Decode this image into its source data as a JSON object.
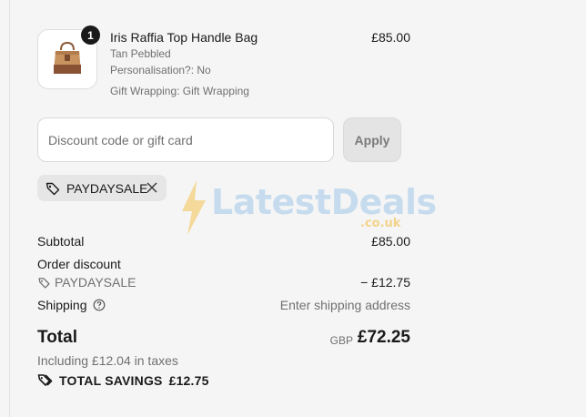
{
  "cart_item": {
    "quantity": "1",
    "title": "Iris Raffia Top Handle Bag",
    "price": "£85.00",
    "variant": "Tan Pebbled",
    "personalisation": "Personalisation?: No",
    "gift_wrapping": "Gift Wrapping: Gift Wrapping",
    "thumbnail_icon": "handbag-icon"
  },
  "discount": {
    "placeholder": "Discount code or gift card",
    "apply_label": "Apply",
    "applied_code": "PAYDAYSALE"
  },
  "watermark": {
    "brand": "LatestDeals",
    "domain": ".co.uk"
  },
  "summary": {
    "subtotal_label": "Subtotal",
    "subtotal_value": "£85.00",
    "order_discount_label": "Order discount",
    "discount_code": "PAYDAYSALE",
    "discount_value": "− £12.75",
    "shipping_label": "Shipping",
    "shipping_value": "Enter shipping address",
    "total_label": "Total",
    "total_currency": "GBP",
    "total_value": "£72.25",
    "tax_note": "Including £12.04 in taxes",
    "savings_label": "TOTAL SAVINGS",
    "savings_value": "£12.75"
  },
  "colors": {
    "background": "#f5f5f5",
    "text": "#1a1a1a",
    "muted": "#707070",
    "watermark_blue": "#c6dcee",
    "watermark_bolt": "#f3d38a"
  }
}
